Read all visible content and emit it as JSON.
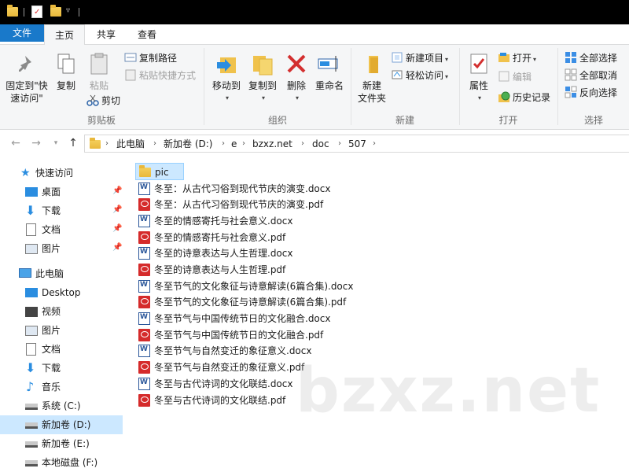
{
  "ribbon_tabs": [
    "文件",
    "主页",
    "共享",
    "查看"
  ],
  "ribbon": {
    "clipboard": {
      "pin_label_1": "固定到\"快",
      "pin_label_2": "速访问\"",
      "copy": "复制",
      "paste": "粘贴",
      "copy_path": "复制路径",
      "paste_shortcut": "粘贴快捷方式",
      "cut": "剪切",
      "group": "剪贴板"
    },
    "organize": {
      "move_to": "移动到",
      "copy_to": "复制到",
      "delete": "删除",
      "rename": "重命名",
      "group": "组织"
    },
    "new": {
      "new_folder_1": "新建",
      "new_folder_2": "文件夹",
      "new_item": "新建项目",
      "easy_access": "轻松访问",
      "group": "新建"
    },
    "open": {
      "properties": "属性",
      "open": "打开",
      "edit": "编辑",
      "history": "历史记录",
      "group": "打开"
    },
    "select": {
      "select_all": "全部选择",
      "select_none": "全部取消",
      "invert": "反向选择",
      "group": "选择"
    }
  },
  "breadcrumb": [
    "此电脑",
    "新加卷 (D:)",
    "e",
    "bzxz.net",
    "doc",
    "507"
  ],
  "nav_pane": {
    "quick_access": "快速访问",
    "quick_items": [
      "桌面",
      "下载",
      "文档",
      "图片"
    ],
    "this_pc": "此电脑",
    "pc_items": [
      "Desktop",
      "视频",
      "图片",
      "文档",
      "下载",
      "音乐",
      "系统 (C:)",
      "新加卷 (D:)",
      "新加卷 (E:)",
      "本地磁盘 (F:)"
    ]
  },
  "files": [
    {
      "name": "pic",
      "type": "folder"
    },
    {
      "name": "冬至：从古代习俗到现代节庆的演变.docx",
      "type": "docx"
    },
    {
      "name": "冬至：从古代习俗到现代节庆的演变.pdf",
      "type": "pdf"
    },
    {
      "name": "冬至的情感寄托与社会意义.docx",
      "type": "docx"
    },
    {
      "name": "冬至的情感寄托与社会意义.pdf",
      "type": "pdf"
    },
    {
      "name": "冬至的诗意表达与人生哲理.docx",
      "type": "docx"
    },
    {
      "name": "冬至的诗意表达与人生哲理.pdf",
      "type": "pdf"
    },
    {
      "name": "冬至节气的文化象征与诗意解读(6篇合集).docx",
      "type": "docx"
    },
    {
      "name": "冬至节气的文化象征与诗意解读(6篇合集).pdf",
      "type": "pdf"
    },
    {
      "name": "冬至节气与中国传统节日的文化融合.docx",
      "type": "docx"
    },
    {
      "name": "冬至节气与中国传统节日的文化融合.pdf",
      "type": "pdf"
    },
    {
      "name": "冬至节气与自然变迁的象征意义.docx",
      "type": "docx"
    },
    {
      "name": "冬至节气与自然变迁的象征意义.pdf",
      "type": "pdf"
    },
    {
      "name": "冬至与古代诗词的文化联结.docx",
      "type": "docx"
    },
    {
      "name": "冬至与古代诗词的文化联结.pdf",
      "type": "pdf"
    }
  ],
  "watermark": "bzxz.net",
  "colors": {
    "file_tab": "#1979ca",
    "selection": "#cce8ff",
    "folder": "#e9b83b",
    "pdf": "#d52b2b",
    "word": "#2b579a"
  }
}
